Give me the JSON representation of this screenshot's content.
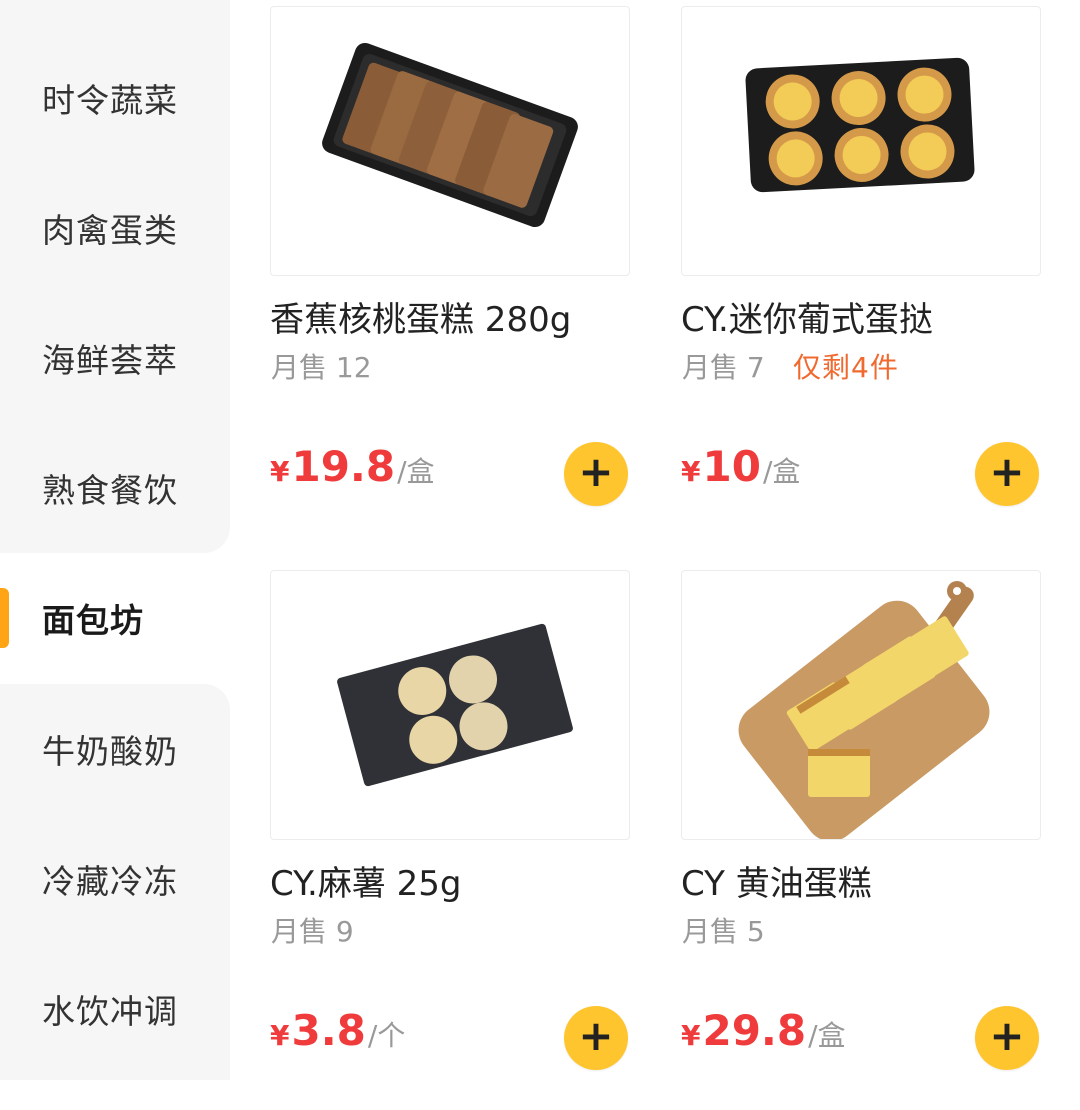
{
  "sidebar": {
    "categories": [
      {
        "label": "时令蔬菜"
      },
      {
        "label": "肉禽蛋类"
      },
      {
        "label": "海鲜荟萃"
      },
      {
        "label": "熟食餐饮"
      },
      {
        "label": "面包坊"
      },
      {
        "label": "牛奶酸奶"
      },
      {
        "label": "冷藏冷冻"
      },
      {
        "label": "水饮冲调"
      }
    ],
    "active_index": 4
  },
  "products": [
    {
      "title": "香蕉核桃蛋糕 280g",
      "sales": "月售 12",
      "stock_note": "",
      "currency": "¥",
      "price": "19.8",
      "unit": "/盒",
      "add_label": "+"
    },
    {
      "title": "CY.迷你葡式蛋挞",
      "sales": "月售 7",
      "stock_note": "仅剩4件",
      "currency": "¥",
      "price": "10",
      "unit": "/盒",
      "add_label": "+"
    },
    {
      "title": "CY.麻薯 25g",
      "sales": "月售 9",
      "stock_note": "",
      "currency": "¥",
      "price": "3.8",
      "unit": "/个",
      "add_label": "+"
    },
    {
      "title": "CY 黄油蛋糕",
      "sales": "月售 5",
      "stock_note": "",
      "currency": "¥",
      "price": "29.8",
      "unit": "/盒",
      "add_label": "+"
    }
  ],
  "colors": {
    "accent": "#ffc52e",
    "price": "#ef3b3b",
    "stock_warning": "#f06a2f",
    "active_indicator": "#ffa515"
  }
}
